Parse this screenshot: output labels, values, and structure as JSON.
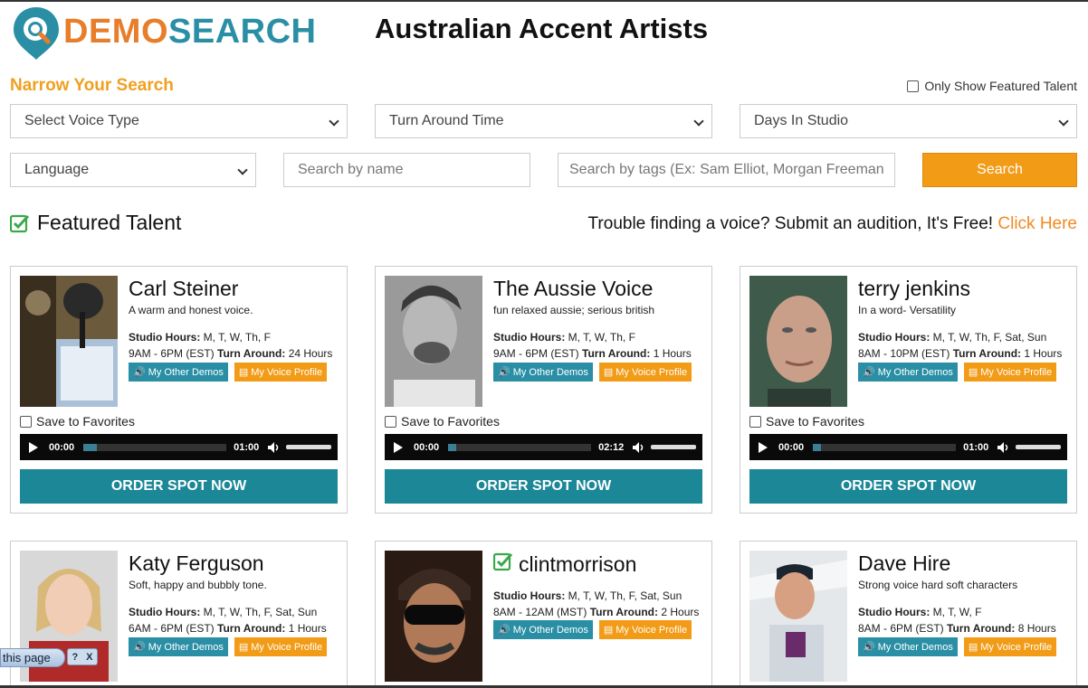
{
  "logo": {
    "part1": "DEMO",
    "part2": "SEARCH"
  },
  "page_title": "Australian Accent Artists",
  "filters": {
    "heading": "Narrow Your Search",
    "only_featured_label": "Only Show Featured Talent",
    "voice_type": "Select Voice Type",
    "turn_around": "Turn Around Time",
    "days_in_studio": "Days In Studio",
    "language": "Language",
    "name_placeholder": "Search by name",
    "tags_placeholder": "Search by tags (Ex: Sam Elliot, Morgan Freeman",
    "search_button": "Search"
  },
  "featured": {
    "heading": "Featured Talent",
    "trouble_text": "Trouble finding a voice? Submit an audition, It's Free!",
    "click_here": "Click Here"
  },
  "labels": {
    "studio_hours": "Studio Hours:",
    "turn_around": "Turn Around:",
    "other_demos": "My Other Demos",
    "voice_profile": "My Voice Profile",
    "save_favorites": "Save to Favorites",
    "order": "ORDER SPOT NOW"
  },
  "talents": [
    {
      "name": "Carl Steiner",
      "tagline": "A warm and honest voice.",
      "days": "M, T, W, Th, F",
      "time": "9AM - 6PM (EST)",
      "turn_around": "24 Hours",
      "current": "00:00",
      "duration": "01:00"
    },
    {
      "name": "The Aussie Voice",
      "tagline": "fun relaxed aussie; serious british",
      "days": "M, T, W, Th, F",
      "time": "9AM - 6PM (EST)",
      "turn_around": "1 Hours",
      "current": "00:00",
      "duration": "02:12"
    },
    {
      "name": "terry jenkins",
      "tagline": "In a word- Versatility",
      "days": "M, T, W, Th, F, Sat, Sun",
      "time": "8AM - 10PM (EST)",
      "turn_around": "1 Hours",
      "current": "00:00",
      "duration": "01:00"
    },
    {
      "name": "Katy Ferguson",
      "tagline": "Soft, happy and bubbly tone.",
      "days": "M, T, W, Th, F, Sat, Sun",
      "time": "6AM - 6PM (EST)",
      "turn_around": "1 Hours"
    },
    {
      "name": "clintmorrison",
      "tagline": "",
      "days": "M, T, W, Th, F, Sat, Sun",
      "time": "8AM - 12AM (MST)",
      "turn_around": "2 Hours"
    },
    {
      "name": "Dave Hire",
      "tagline": "Strong voice hard soft characters",
      "days": "M, T, W, F",
      "time": "8AM - 6PM (EST)",
      "turn_around": "8 Hours"
    }
  ],
  "browser_tab": {
    "label": "this page",
    "help": "?",
    "close": "X"
  },
  "colors": {
    "orange": "#f29b16",
    "teal": "#1b8797",
    "blue": "#2a8fa5",
    "green": "#3aa84a"
  }
}
